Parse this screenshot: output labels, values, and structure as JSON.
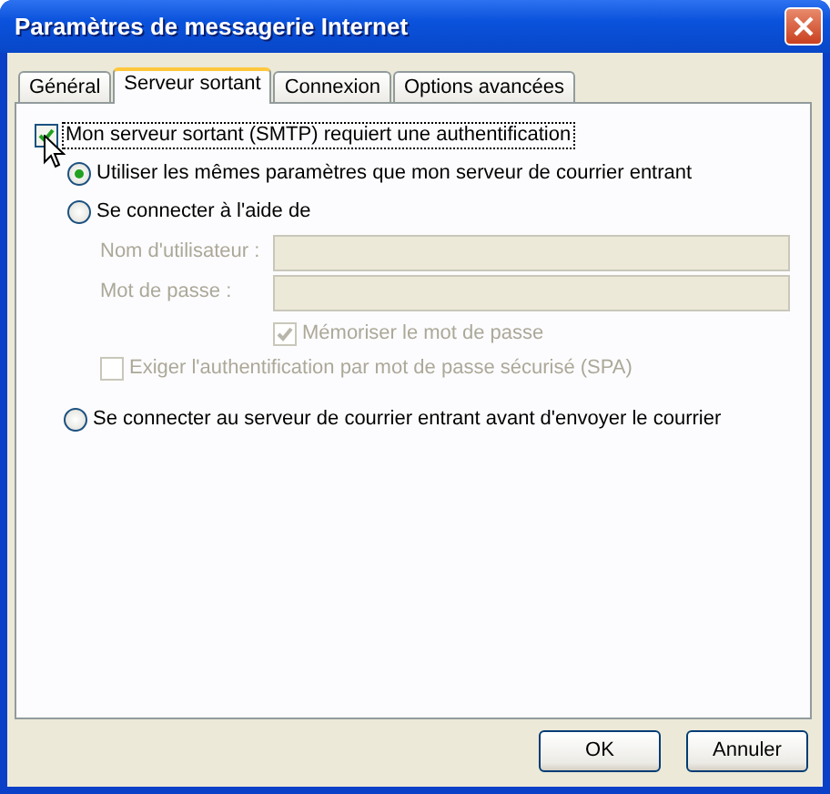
{
  "window": {
    "title": "Paramètres de messagerie Internet"
  },
  "tabs": [
    {
      "label": "Général",
      "selected": false
    },
    {
      "label": "Serveur sortant",
      "selected": true
    },
    {
      "label": "Connexion",
      "selected": false
    },
    {
      "label": "Options avancées",
      "selected": false
    }
  ],
  "auth": {
    "label": "Mon serveur sortant (SMTP) requiert une authentification",
    "checked": true
  },
  "auth_options": [
    {
      "label": "Utiliser les mêmes paramètres que mon serveur de courrier entrant",
      "selected": true
    },
    {
      "label": "Se connecter à l'aide de",
      "selected": false
    }
  ],
  "credentials": {
    "disabled": true,
    "fields": [
      {
        "label": "Nom d'utilisateur :"
      },
      {
        "label": "Mot de passe :"
      }
    ],
    "remember": {
      "label": "Mémoriser le mot de passe",
      "checked": true
    },
    "spa": {
      "label": "Exiger l'authentification par mot de passe sécurisé (SPA)",
      "checked": false
    }
  },
  "connect_before_send": {
    "label": "Se connecter au serveur de courrier entrant avant d'envoyer le courrier",
    "selected": false
  },
  "buttons": [
    {
      "label": "OK"
    },
    {
      "label": "Annuler"
    }
  ]
}
